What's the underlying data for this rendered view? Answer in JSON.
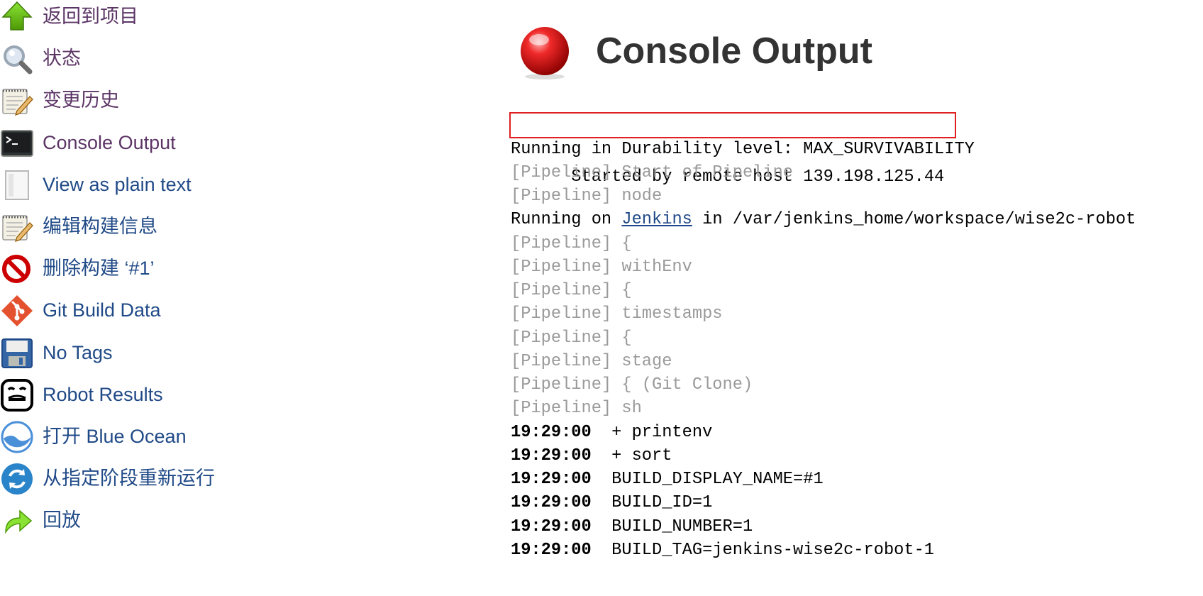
{
  "sidebar": {
    "items": [
      {
        "label": "返回到项目",
        "icon": "up-arrow-icon"
      },
      {
        "label": "状态",
        "icon": "magnifier-icon"
      },
      {
        "label": "变更历史",
        "icon": "notepad-icon"
      },
      {
        "label": "Console Output",
        "icon": "terminal-icon"
      },
      {
        "label": "View as plain text",
        "icon": "document-icon"
      },
      {
        "label": "编辑构建信息",
        "icon": "notepad-edit-icon"
      },
      {
        "label": "删除构建 ‘#1’",
        "icon": "no-entry-icon"
      },
      {
        "label": "Git Build Data",
        "icon": "git-icon"
      },
      {
        "label": "No Tags",
        "icon": "floppy-disk-icon"
      },
      {
        "label": "Robot Results",
        "icon": "robot-icon"
      },
      {
        "label": "打开 Blue Ocean",
        "icon": "blue-ocean-icon"
      },
      {
        "label": "从指定阶段重新运行",
        "icon": "restart-icon"
      },
      {
        "label": "回放",
        "icon": "replay-arrow-icon"
      }
    ]
  },
  "main": {
    "title": "Console Output",
    "status_icon": "red-ball-icon",
    "status_color": "#e02020",
    "console": {
      "started_by": "Started by remote host 139.198.125.44",
      "durability": "Running in Durability level: MAX_SURVIVABILITY",
      "pipeline_lines": [
        "[Pipeline] Start of Pipeline",
        "[Pipeline] node"
      ],
      "running_on_prefix": "Running on ",
      "running_on_link": "Jenkins",
      "running_on_suffix": " in /var/jenkins_home/workspace/wise2c-robot",
      "pipeline_lines_2": [
        "[Pipeline] {",
        "[Pipeline] withEnv",
        "[Pipeline] {",
        "[Pipeline] timestamps",
        "[Pipeline] {",
        "[Pipeline] stage",
        "[Pipeline] { (Git Clone)",
        "[Pipeline] sh"
      ],
      "timestamped_lines": [
        {
          "ts": "19:29:00",
          "text": "  + printenv"
        },
        {
          "ts": "19:29:00",
          "text": "  + sort"
        },
        {
          "ts": "19:29:00",
          "text": "  BUILD_DISPLAY_NAME=#1"
        },
        {
          "ts": "19:29:00",
          "text": "  BUILD_ID=1"
        },
        {
          "ts": "19:29:00",
          "text": "  BUILD_NUMBER=1"
        },
        {
          "ts": "19:29:00",
          "text": "  BUILD_TAG=jenkins-wise2c-robot-1"
        }
      ]
    }
  },
  "colors": {
    "link": "#204a87",
    "visited_link": "#5c3566",
    "pipeline_gray": "#9a9a9a",
    "highlight_red": "#e02020"
  }
}
